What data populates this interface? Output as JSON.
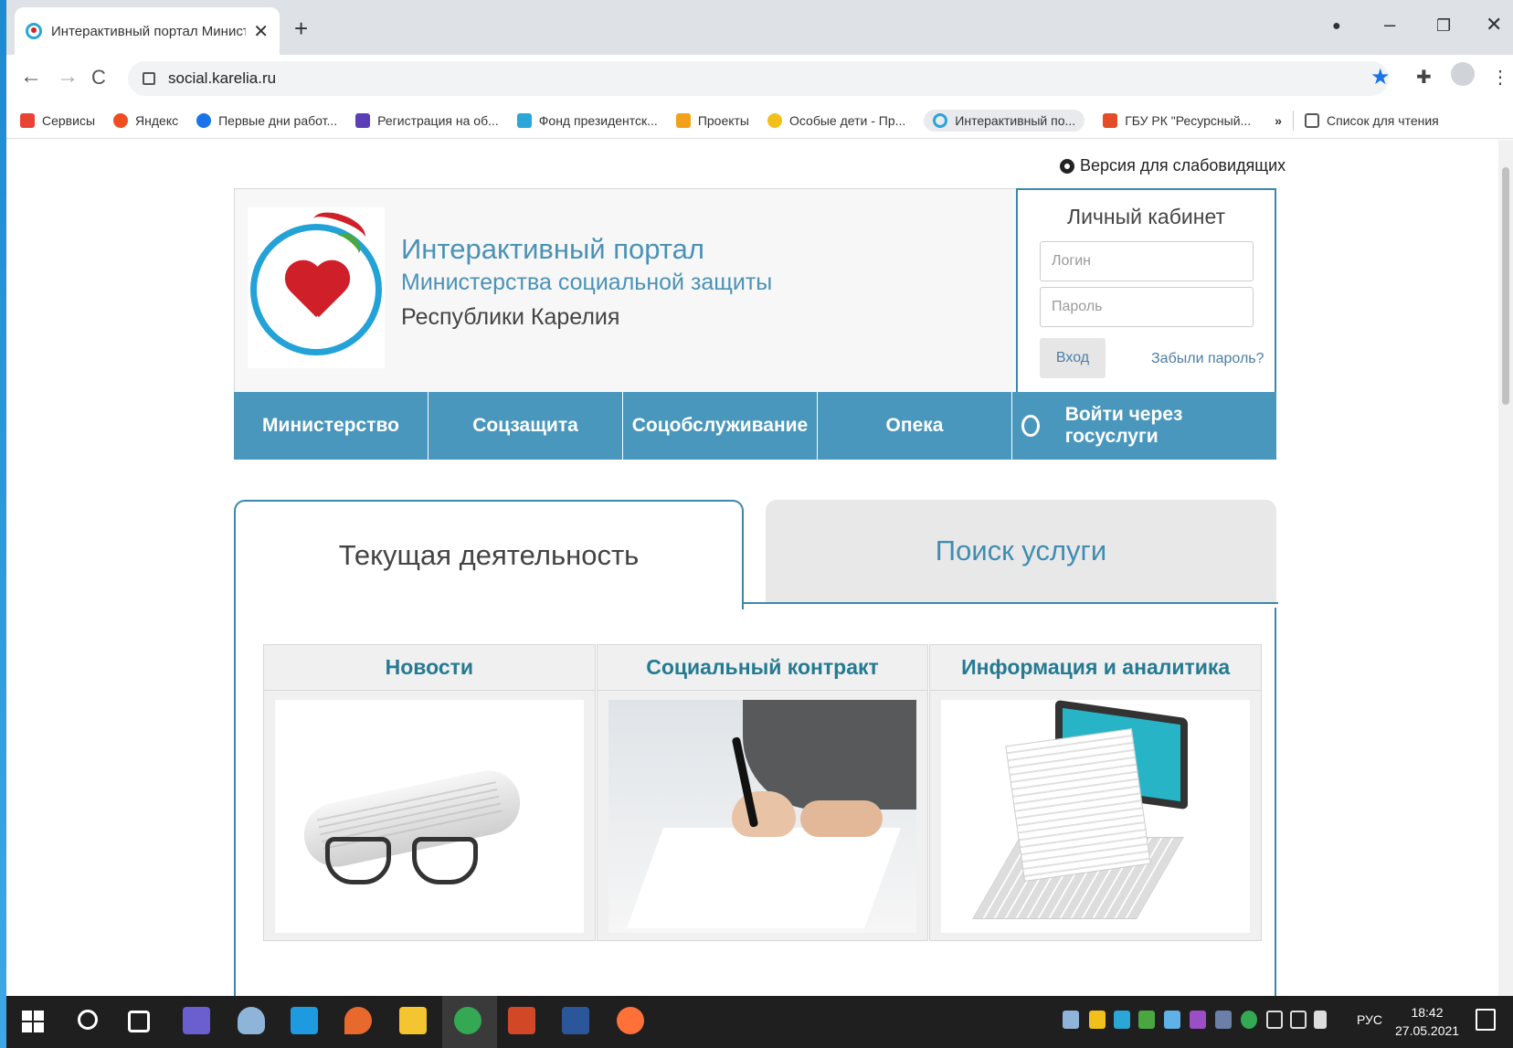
{
  "browser": {
    "tab_title": "Интерактивный портал Минист",
    "tab_close": "✕",
    "new_tab": "+",
    "url": "social.karelia.ru",
    "window_controls": {
      "minimize": "–",
      "restore": "❐",
      "close": "✕"
    },
    "nav": {
      "back": "←",
      "forward": "→",
      "reload": "C"
    }
  },
  "bookmarks": [
    {
      "label": "Сервисы",
      "color": "#ea4335"
    },
    {
      "label": "Яндекс",
      "color": "#ef4e23"
    },
    {
      "label": "Первые дни работ...",
      "color": "#1a73e8"
    },
    {
      "label": "Регистрация на об...",
      "color": "#5a3fb5"
    },
    {
      "label": "Фонд президентск...",
      "color": "#2aa6d7"
    },
    {
      "label": "Проекты",
      "color": "#f1a21a"
    },
    {
      "label": "Особые дети - Пр...",
      "color": "#f1c01a"
    },
    {
      "label": "Интерактивный по...",
      "color": "#2aa6d7"
    },
    {
      "label": "ГБУ РК \"Ресурсный...",
      "color": "#e34c26"
    }
  ],
  "bookmarks_more": "»",
  "reading_list": "Список для чтения",
  "page": {
    "low_vision_link": "Версия для слабовидящих",
    "header": {
      "title_line1": "Интерактивный портал",
      "title_line2": "Министерства социальной защиты",
      "title_line3": "Республики Карелия"
    },
    "cabinet": {
      "title": "Личный кабинет",
      "login_placeholder": "Логин",
      "password_placeholder": "Пароль",
      "login_button": "Вход",
      "forgot_link": "Забыли пароль?"
    },
    "nav": [
      {
        "label": "Министерство"
      },
      {
        "label": "Соцзащита"
      },
      {
        "label": "Соцобслуживание"
      },
      {
        "label": "Опека"
      },
      {
        "label": "Войти через госуслуги"
      }
    ],
    "tabs": {
      "current": "Текущая деятельность",
      "search": "Поиск услуги"
    },
    "cards": [
      {
        "title": "Новости"
      },
      {
        "title": "Социальный контракт"
      },
      {
        "title": "Информация и аналитика"
      }
    ]
  },
  "taskbar": {
    "lang": "РУС",
    "time": "18:42",
    "date": "27.05.2021"
  },
  "colors": {
    "nav_bg": "#4a97bd",
    "accent_border": "#3b88ad",
    "card_title": "#257a92",
    "logo_red": "#cf1f28",
    "logo_blue": "#23a2d8"
  }
}
